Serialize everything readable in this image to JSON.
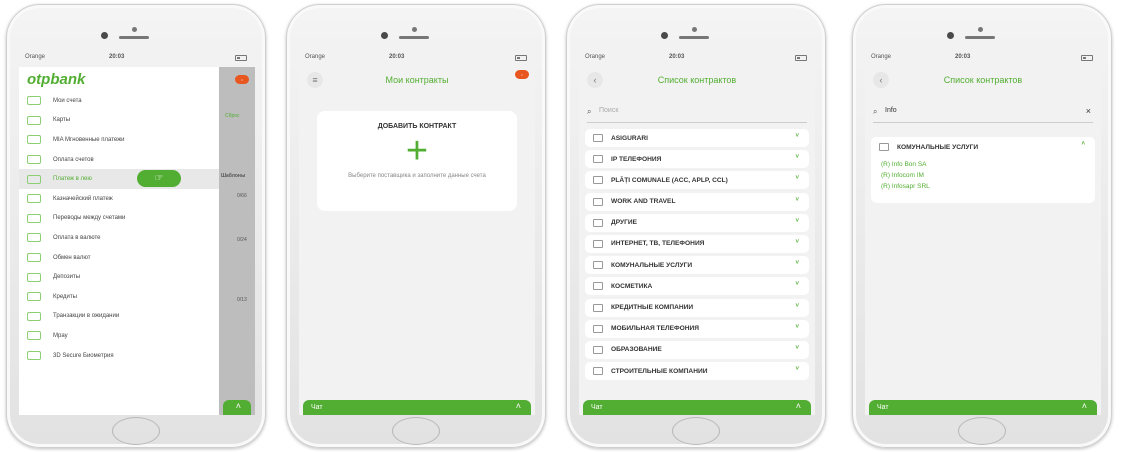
{
  "status": {
    "carrier": "Orange",
    "time": "20:03"
  },
  "chat_label": "Чат",
  "menu": {
    "logo": "otpbank",
    "items": [
      "Мои счета",
      "Карты",
      "MIA Мгновенные платежи",
      "Оплата счетов",
      "Платеж в лею",
      "Казначейский платеж",
      "Переводы между счетами",
      "Оплата в валюте",
      "Обмен валют",
      "Депозиты",
      "Кредиты",
      "Транзакции в ожидании",
      "Mpay",
      "3D Secure Биометрия"
    ],
    "selected_index": 4,
    "behind": {
      "reset": "Сброс",
      "templates": "Шаблоны",
      "amounts": [
        "0/66",
        "0/24",
        "0/13"
      ]
    }
  },
  "contracts": {
    "title": "Мои контракты",
    "add_title": "ДОБАВИТЬ КОНТРАКТ",
    "add_desc": "Выберите поставщика и заполните данные счета"
  },
  "contract_list": {
    "title": "Список контрактов",
    "search_placeholder": "Поиск",
    "categories": [
      "ASIGURARI",
      "IP ТЕЛЕФОНИЯ",
      "PLĂȚI COMUNALE (ACC, APLP, CCL)",
      "WORK AND TRAVEL",
      "ДРУГИЕ",
      "ИНТЕРНЕТ, ТВ, ТЕЛЕФОНИЯ",
      "КОМУНАЛЬНЫЕ УСЛУГИ",
      "КОСМЕТИКА",
      "КРЕДИТНЫЕ КОМПАНИИ",
      "МОБИЛЬНАЯ ТЕЛЕФОНИЯ",
      "ОБРАЗОВАНИЕ",
      "СТРОИТЕЛЬНЫЕ КОМПАНИИ"
    ]
  },
  "search_results": {
    "title": "Список контрактов",
    "query": "Info",
    "category": "КОМУНАЛЬНЫЕ УСЛУГИ",
    "results": [
      "(R) Info Bon SA",
      "(R) Infocom IM",
      "(R) Infosapr SRL"
    ]
  }
}
